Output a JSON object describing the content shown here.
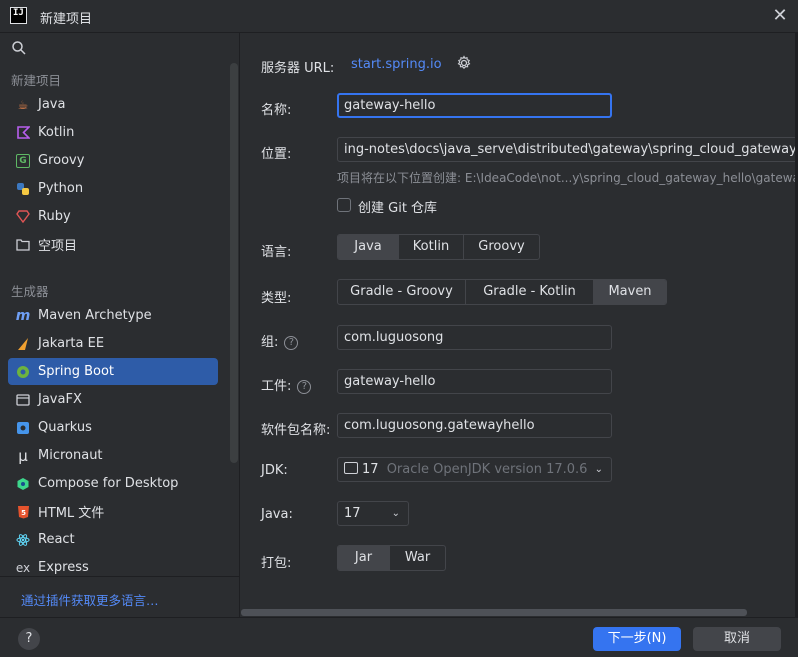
{
  "window": {
    "title": "新建项目",
    "logo": "IJ"
  },
  "sidebar": {
    "new_project_section": "新建项目",
    "new_items": [
      {
        "label": "Java",
        "icon": "java-icon"
      },
      {
        "label": "Kotlin",
        "icon": "kotlin-icon"
      },
      {
        "label": "Groovy",
        "icon": "groovy-icon"
      },
      {
        "label": "Python",
        "icon": "python-icon"
      },
      {
        "label": "Ruby",
        "icon": "ruby-icon"
      },
      {
        "label": "空项目",
        "icon": "empty-project-icon"
      }
    ],
    "generators_section": "生成器",
    "generator_items": [
      {
        "label": "Maven Archetype",
        "icon": "maven-icon"
      },
      {
        "label": "Jakarta EE",
        "icon": "jakarta-icon"
      },
      {
        "label": "Spring Boot",
        "icon": "spring-boot-icon",
        "selected": true
      },
      {
        "label": "JavaFX",
        "icon": "javafx-icon"
      },
      {
        "label": "Quarkus",
        "icon": "quarkus-icon"
      },
      {
        "label": "Micronaut",
        "icon": "micronaut-icon"
      },
      {
        "label": "Compose for Desktop",
        "icon": "compose-icon"
      },
      {
        "label": "HTML 文件",
        "icon": "html-icon"
      },
      {
        "label": "React",
        "icon": "react-icon"
      },
      {
        "label": "Express",
        "icon": "express-icon"
      }
    ],
    "plugin_link": "通过插件获取更多语言…"
  },
  "form": {
    "server_url_label": "服务器 URL:",
    "server_url_value": "start.spring.io",
    "name_label": "名称:",
    "name_value": "gateway-hello",
    "location_label": "位置:",
    "location_value": "ing-notes\\docs\\java_serve\\distributed\\gateway\\spring_cloud_gateway_he",
    "location_hint": "项目将在以下位置创建: E:\\IdeaCode\\not...y\\spring_cloud_gateway_hello\\gateway-h",
    "git_checkbox_label": "创建 Git 仓库",
    "language_label": "语言:",
    "language_options": [
      "Java",
      "Kotlin",
      "Groovy"
    ],
    "type_label": "类型:",
    "type_options": [
      "Gradle - Groovy",
      "Gradle - Kotlin",
      "Maven"
    ],
    "group_label": "组:",
    "group_value": "com.luguosong",
    "artifact_label": "工件:",
    "artifact_value": "gateway-hello",
    "package_label": "软件包名称:",
    "package_value": "com.luguosong.gatewayhello",
    "jdk_label": "JDK:",
    "jdk_version": "17",
    "jdk_desc": "Oracle OpenJDK version 17.0.6",
    "java_label": "Java:",
    "java_value": "17",
    "packaging_label": "打包:",
    "packaging_options": [
      "Jar",
      "War"
    ]
  },
  "footer": {
    "help": "?",
    "next_label": "下一步(N)",
    "cancel_label": "取消"
  }
}
